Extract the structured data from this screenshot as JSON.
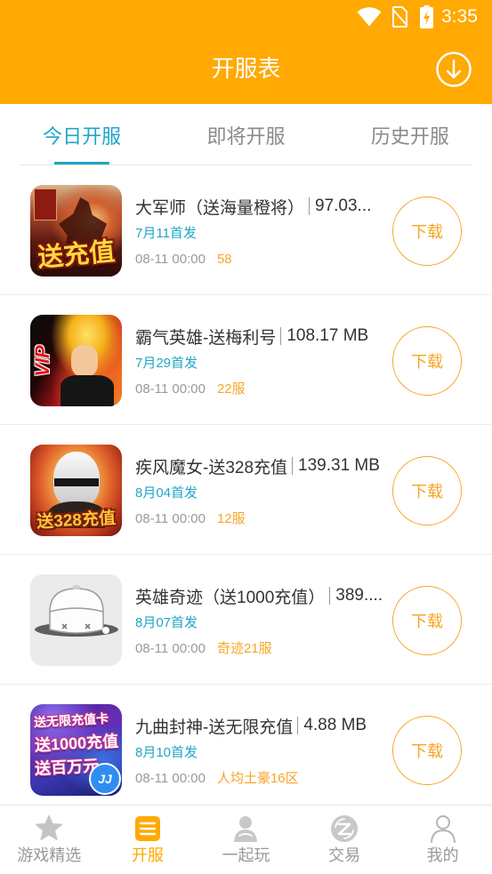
{
  "status_bar": {
    "time": "3:35",
    "icons": [
      "wifi-icon",
      "no-sim-icon",
      "battery-charging-icon"
    ]
  },
  "header": {
    "title": "开服表",
    "action_icon": "download-circle-icon"
  },
  "tabs": [
    {
      "label": "今日开服",
      "active": true
    },
    {
      "label": "即将开服",
      "active": false
    },
    {
      "label": "历史开服",
      "active": false
    }
  ],
  "games": [
    {
      "name": "大军师（送海量橙将）",
      "size": "97.03...",
      "first_release": "7月11首发",
      "open_time": "08-11 00:00",
      "server": "58",
      "action": "下载",
      "icon_text": [
        "送充值"
      ]
    },
    {
      "name": "霸气英雄-送梅利号",
      "size": "108.17 MB",
      "first_release": "7月29首发",
      "open_time": "08-11 00:00",
      "server": "22服",
      "action": "下载",
      "icon_text": [
        "VIP"
      ]
    },
    {
      "name": "疾风魔女-送328充值",
      "size": "139.31 MB",
      "first_release": "8月04首发",
      "open_time": "08-11 00:00",
      "server": "12服",
      "action": "下载",
      "icon_text": [
        "送328充值"
      ]
    },
    {
      "name": "英雄奇迹（送1000充值）",
      "size": "389....",
      "first_release": "8月07首发",
      "open_time": "08-11 00:00",
      "server": "奇迹21服",
      "action": "下载",
      "icon_text": [],
      "icon": "placeholder-image-icon"
    },
    {
      "name": "九曲封神-送无限充值",
      "size": "4.88 MB",
      "first_release": "8月10首发",
      "open_time": "08-11 00:00",
      "server": "人均土豪16区",
      "action": "下载",
      "icon_text": [
        "送无限充值卡",
        "送1000充值",
        "送百万元",
        "JJ"
      ]
    }
  ],
  "bottom_nav": [
    {
      "label": "游戏精选",
      "icon": "star-icon",
      "active": false
    },
    {
      "label": "开服",
      "icon": "server-list-icon",
      "active": true
    },
    {
      "label": "一起玩",
      "icon": "play-together-icon",
      "active": false
    },
    {
      "label": "交易",
      "icon": "trade-icon",
      "active": false
    },
    {
      "label": "我的",
      "icon": "profile-icon",
      "active": false
    }
  ],
  "colors": {
    "primary": "#FFA902",
    "accent": "#1FA5C8",
    "highlight": "#F5A623",
    "muted_text": "#999999",
    "title_text": "#333333"
  }
}
